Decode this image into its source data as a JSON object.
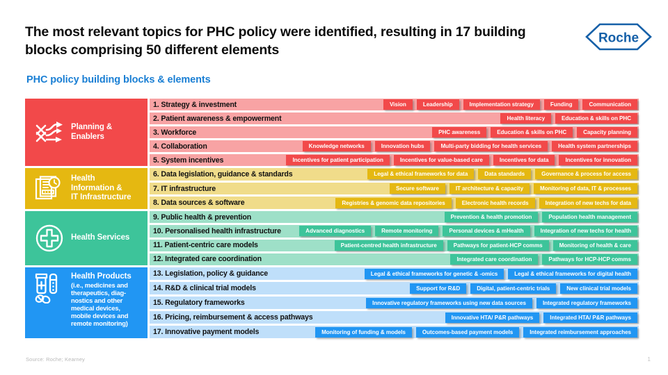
{
  "header": {
    "title": "The most relevant topics for PHC policy were identified, resulting in 17 building blocks comprising 50 different elements",
    "subtitle": "PHC policy building blocks & elements",
    "logo_text": "Roche",
    "logo_color": "#1560A8"
  },
  "footer": {
    "source": "Source: Roche; Kearney",
    "page_number": "1"
  },
  "colors": {
    "red": "#F2494A",
    "red_light": "#F8A3A4",
    "yellow": "#E5B811",
    "yellow_light": "#F0DC8A",
    "green": "#3DC49A",
    "green_light": "#9EE0C8",
    "blue": "#2196F3",
    "blue_light": "#BFDFFA",
    "subtitle_blue": "#1A7FD4"
  },
  "matrix": {
    "groups": [
      {
        "id": "planning-enablers",
        "color_key": "red",
        "icon": "arrows-crossing-icon",
        "title": "Planning &",
        "title2": "Enablers",
        "sub": "",
        "rows": [
          {
            "label": "1. Strategy & investment",
            "elements": [
              "Vision",
              "Leadership",
              "Implementation strategy",
              "Funding",
              "Communication"
            ]
          },
          {
            "label": "2. Patient awareness & empowerment",
            "elements": [
              "Health literacy",
              "Education & skills on PHC"
            ]
          },
          {
            "label": "3. Workforce",
            "elements": [
              "PHC awareness",
              "Education & skills on PHC",
              "Capacity planning"
            ]
          },
          {
            "label": "4. Collaboration",
            "elements": [
              "Knowledge networks",
              "Innovation hubs",
              "Multi-party bidding for health services",
              "Health system partnerships"
            ]
          },
          {
            "label": "5. System incentives",
            "elements": [
              "Incentives for patient participation",
              "Incentives for value-based care",
              "Incentives for data",
              "Incentives for innovation"
            ]
          }
        ]
      },
      {
        "id": "health-information-it-infrastructure",
        "color_key": "yellow",
        "icon": "documents-clock-icon",
        "title": "Health",
        "title2": "Information &",
        "title3": "IT Infrastructure",
        "sub": "",
        "rows": [
          {
            "label": "6. Data legislation, guidance & standards",
            "elements": [
              "Legal & ethical frameworks for data",
              "Data standards",
              "Governance & process for access"
            ]
          },
          {
            "label": "7. IT infrastructure",
            "elements": [
              "Secure software",
              "IT architecture & capacity",
              "Monitoring of data, IT & processes"
            ]
          },
          {
            "label": "8. Data sources & software",
            "elements": [
              "Registries & genomic data repositories",
              "Electronic health records",
              "Integration of new techs for data"
            ]
          }
        ]
      },
      {
        "id": "health-services",
        "color_key": "green",
        "icon": "medical-cross-icon",
        "title": "Health Services",
        "title2": "",
        "sub": "",
        "rows": [
          {
            "label": "9. Public health & prevention",
            "elements": [
              "Prevention & health promotion",
              "Population health management"
            ]
          },
          {
            "label": "10. Personalised health infrastructure",
            "elements": [
              "Advanced diagnostics",
              "Remote monitoring",
              "Personal devices & mHealth",
              "Integration of new techs for health"
            ]
          },
          {
            "label": "11. Patient-centric care models",
            "elements": [
              "Patient-centred health infrastructure",
              "Pathways for patient-HCP comms",
              "Monitoring of health & care"
            ]
          },
          {
            "label": "12. Integrated care coordination",
            "elements": [
              "Integrated care coordination",
              "Pathways for HCP-HCP comms"
            ]
          }
        ]
      },
      {
        "id": "health-products",
        "color_key": "blue",
        "icon": "medicine-bottle-pills-icon",
        "title": "Health Products",
        "title2": "",
        "sub": "(i.e., medicines and therapeutics, diag-nostics and other medical devices, mobile devices and remote monitoring)",
        "sub_lines": [
          "(i.e., medicines and",
          "therapeutics, diag-",
          "nostics and other",
          "medical devices,",
          "mobile devices and",
          "remote monitoring)"
        ],
        "rows": [
          {
            "label": "13. Legislation, policy & guidance",
            "elements": [
              "Legal & ethical frameworks for genetic & -omics",
              "Legal & ethical frameworks for digital health"
            ]
          },
          {
            "label": "14. R&D & clinical trial models",
            "elements": [
              "Support for R&D",
              "Digital, patient-centric trials",
              "New clinical trial models"
            ]
          },
          {
            "label": "15. Regulatory frameworks",
            "elements": [
              "Innovative regulatory frameworks using new data sources",
              "Integrated regulatory frameworks"
            ]
          },
          {
            "label": "16. Pricing, reimbursement & access pathways",
            "elements": [
              "Innovative HTA/ P&R pathways",
              "Integrated HTA/ P&R pathways"
            ]
          },
          {
            "label": "17. Innovative payment models",
            "elements": [
              "Monitoring of funding & models",
              "Outcomes-based payment models",
              "Integrated reimbursement approaches"
            ]
          }
        ]
      }
    ]
  }
}
